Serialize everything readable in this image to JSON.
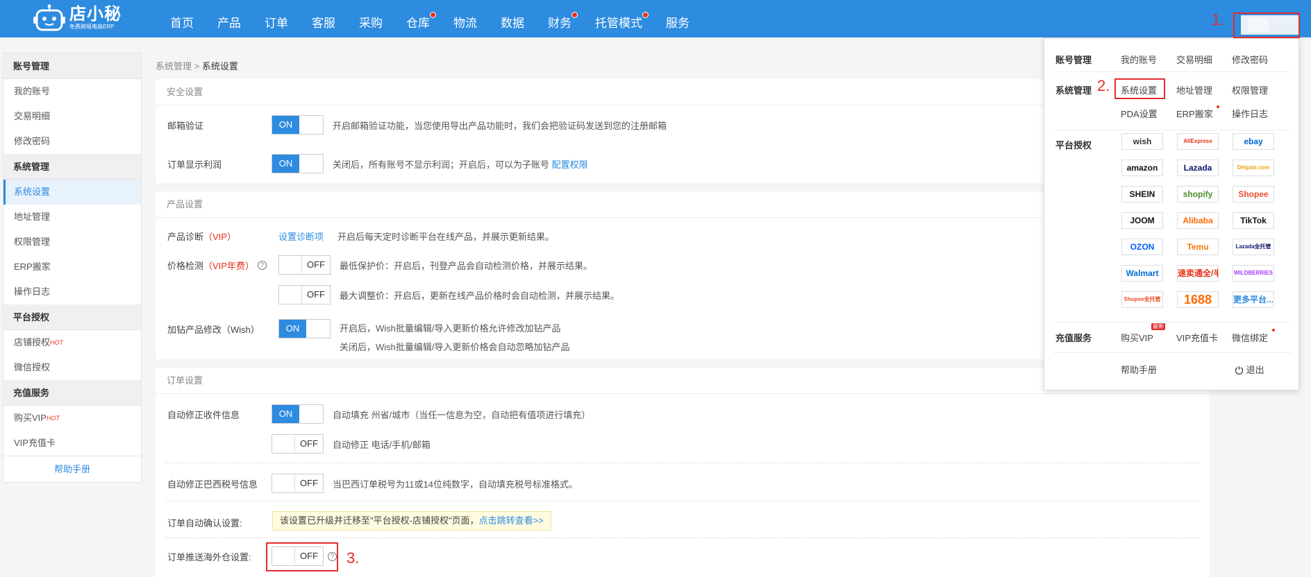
{
  "brand": {
    "title": "店小秘",
    "subtitle": "免费跨境电商ERP"
  },
  "nav": [
    {
      "label": "首页",
      "dot": false
    },
    {
      "label": "产品",
      "dot": false
    },
    {
      "label": "订单",
      "dot": false
    },
    {
      "label": "客服",
      "dot": false
    },
    {
      "label": "采购",
      "dot": false
    },
    {
      "label": "仓库",
      "dot": true
    },
    {
      "label": "物流",
      "dot": false
    },
    {
      "label": "数据",
      "dot": false
    },
    {
      "label": "财务",
      "dot": true
    },
    {
      "label": "托管模式",
      "dot": true
    },
    {
      "label": "服务",
      "dot": false
    }
  ],
  "sidebar": {
    "groups": [
      {
        "title": "账号管理",
        "items": [
          {
            "label": "我的账号"
          },
          {
            "label": "交易明细"
          },
          {
            "label": "修改密码"
          }
        ]
      },
      {
        "title": "系统管理",
        "items": [
          {
            "label": "系统设置",
            "active": true
          },
          {
            "label": "地址管理"
          },
          {
            "label": "权限管理"
          },
          {
            "label": "ERP搬家"
          },
          {
            "label": "操作日志"
          }
        ]
      },
      {
        "title": "平台授权",
        "items": [
          {
            "label": "店铺授权",
            "hot": "HOT"
          },
          {
            "label": "微信授权"
          }
        ]
      },
      {
        "title": "充值服务",
        "items": [
          {
            "label": "购买VIP",
            "hot": "HOT"
          },
          {
            "label": "VIP充值卡"
          }
        ]
      }
    ],
    "help": "帮助手册"
  },
  "breadcrumb": {
    "parent": "系统管理",
    "sep": " > ",
    "current": "系统设置"
  },
  "security": {
    "title": "安全设置",
    "email_label": "邮箱验证",
    "email_toggle": "ON",
    "email_desc": "开启邮箱验证功能，当您使用导出产品功能时，我们会把验证码发送到您的注册邮箱",
    "profit_label": "订单显示利润",
    "profit_toggle": "ON",
    "profit_desc": "关闭后，所有账号不显示利润；开启后，可以为子账号",
    "profit_link": "配置权限"
  },
  "product": {
    "title": "产品设置",
    "diag_label": "产品诊断",
    "diag_vip": "（VIP）",
    "diag_link": "设置诊断项",
    "diag_desc": "开启后每天定时诊断平台在线产品，并展示更新结果。",
    "price_label": "价格检测",
    "price_vip": "（VIP年费）",
    "price_q": "?",
    "price_toggle1": "OFF",
    "price_desc1": "最低保护价：开启后，刊登产品会自动检测价格，并展示结果。",
    "price_toggle2": "OFF",
    "price_desc2": "最大调整价：开启后，更新在线产品价格时会自动检测，并展示结果。",
    "wish_label": "加钻产品修改（Wish）",
    "wish_toggle": "ON",
    "wish_desc1": "开启后，Wish批量编辑/导入更新价格允许修改加钻产品",
    "wish_desc2": "关闭后，Wish批量编辑/导入更新价格会自动忽略加钻产品"
  },
  "order": {
    "title": "订单设置",
    "fix_label": "自动修正收件信息",
    "fix_toggle1": "ON",
    "fix_desc1": "自动填充 州省/城市（当任一信息为空，自动把有值项进行填充）",
    "fix_toggle2": "OFF",
    "fix_desc2": "自动修正 电话/手机/邮箱",
    "br_label": "自动修正巴西税号信息",
    "br_toggle": "OFF",
    "br_desc": "当巴西订单税号为11或14位纯数字，自动填充税号标准格式。",
    "confirm_label": "订单自动确认设置:",
    "confirm_notice": "该设置已升级并迁移至\"平台授权-店铺授权\"页面，",
    "confirm_link": "点击跳转查看>>",
    "overseas_label": "订单推送海外仓设置:",
    "overseas_toggle": "OFF",
    "overseas_q": "?"
  },
  "annotations": {
    "a1": "1.",
    "a2": "2.",
    "a3": "3."
  },
  "dropdown": {
    "account": {
      "label": "账号管理",
      "links": [
        "我的账号",
        "交易明细",
        "修改密码"
      ]
    },
    "system": {
      "label": "系统管理",
      "links": [
        "系统设置",
        "地址管理",
        "权限管理",
        "PDA设置",
        "ERP搬家",
        "操作日志"
      ]
    },
    "platform": {
      "label": "平台授权",
      "logos": [
        {
          "name": "wish",
          "color": "#333333"
        },
        {
          "name": "AliExpress",
          "color": "#e8311b"
        },
        {
          "name": "ebay",
          "color": "#0064d2"
        },
        {
          "name": "amazon",
          "color": "#111111"
        },
        {
          "name": "Lazada",
          "color": "#0f146d"
        },
        {
          "name": "DHgate.com",
          "color": "#e8a317"
        },
        {
          "name": "SHEIN",
          "color": "#111111"
        },
        {
          "name": "shopify",
          "color": "#4a8c2a"
        },
        {
          "name": "Shopee",
          "color": "#ee4d2d"
        },
        {
          "name": "JOOM",
          "color": "#111111"
        },
        {
          "name": "Alibaba",
          "color": "#ff6a00"
        },
        {
          "name": "TikTok",
          "color": "#111111"
        },
        {
          "name": "OZON",
          "color": "#005bff"
        },
        {
          "name": "Temu",
          "color": "#fb7701"
        },
        {
          "name": "Lazada全托管",
          "color": "#0f146d"
        },
        {
          "name": "Walmart",
          "color": "#0071ce"
        },
        {
          "name": "速卖通全/半托管",
          "color": "#e8311b"
        },
        {
          "name": "WILDBERRIES",
          "color": "#a73afd"
        },
        {
          "name": "Shopee全托管",
          "color": "#ee4d2d"
        },
        {
          "name": "1688",
          "color": "#ff6a00"
        },
        {
          "name": "更多平台...",
          "color": "#2d8be0"
        }
      ]
    },
    "recharge": {
      "label": "充值服务",
      "links": [
        "购买VIP",
        "VIP充值卡",
        "微信绑定"
      ],
      "new_badge": "最新"
    },
    "help": "帮助手册",
    "logout": "退出"
  }
}
